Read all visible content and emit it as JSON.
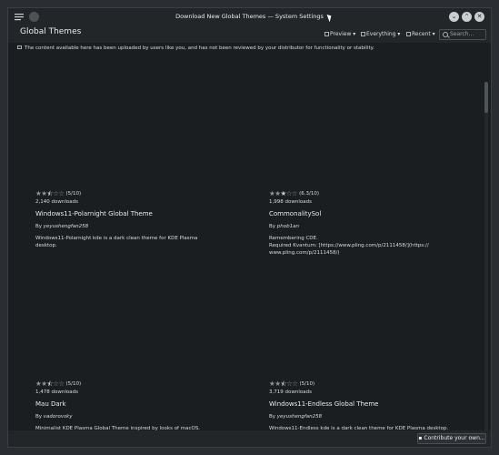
{
  "window": {
    "title": "Download New Global Themes — System Settings"
  },
  "header": {
    "title": "Global Themes",
    "preview_label": "Preview",
    "filter_label": "Everything",
    "sort_label": "Recent",
    "search_placeholder": "Search..."
  },
  "notice": "The content available here has been uploaded by users like you, and has not been reviewed by your distributor for functionality or stability.",
  "cards": [
    {
      "rating_text": "(5/10)",
      "rating_value": 5,
      "downloads": "2,140 downloads",
      "name": "Windows11-Polarnight Global Theme",
      "by": "By",
      "author": "yeyushengfan258",
      "description": "Windows11-Polarnight kde is a dark clean theme for KDE Plasma desktop."
    },
    {
      "rating_text": "(6.3/10)",
      "rating_value": 6.3,
      "downloads": "1,998 downloads",
      "name": "CommonalitySol",
      "by": "By",
      "author": "phob1an",
      "description": "Remembering CDE.\nRequired Kvantum: [https://www.pling.com/p/2111458/](https://\nwww.pling.com/p/2111458/)"
    },
    {
      "rating_text": "(5/10)",
      "rating_value": 5,
      "downloads": "1,478 downloads",
      "name": "Mau Dark",
      "by": "By",
      "author": "vadorovsky",
      "description": "Minimalist KDE Plasma Global Theme inspired by looks of macOS."
    },
    {
      "rating_text": "(5/10)",
      "rating_value": 5,
      "downloads": "3,719 downloads",
      "name": "Windows11-Endless Global Theme",
      "by": "By",
      "author": "yeyushengfan258",
      "description": "Windows11-Endless kde is a dark clean theme for KDE Plasma desktop."
    }
  ],
  "footer": {
    "contribute_label": "Contribute your own..."
  },
  "colors": {
    "background": "#1b1e20",
    "chrome": "#232629",
    "text": "#d8dde2"
  }
}
